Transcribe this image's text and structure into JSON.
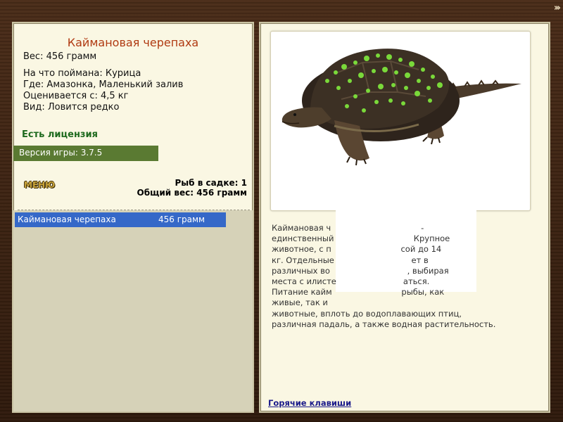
{
  "window": {
    "nav_arrows": "›››"
  },
  "fish": {
    "name": "Каймановая черепаха",
    "weight_label": "Вес: 456 грамм",
    "caught_on": "На что поймана: Курица",
    "location": "Где: Амазонка, Маленький залив",
    "valued_from": "Оценивается с: 4,5 кг",
    "rarity": "Вид: Ловится редко"
  },
  "license": {
    "label": "Есть лицензия",
    "color": "#1e6a1e"
  },
  "version": {
    "label": "Версия игры: 3.7.5",
    "bar_color": "#5a7a32"
  },
  "menu": {
    "label": "МЕНЮ"
  },
  "keepnet": {
    "count_label": "Рыб в садке: 1",
    "total_label": "Общий вес: 456 грамм"
  },
  "catch_list": [
    {
      "name": "Каймановая черепаха",
      "weight": "456 грамм",
      "selected": true
    }
  ],
  "description": "Каймановая черепаха - единственный крупное животное, с п сой до 14 кг. Отдельные ет в различных во , выбирая места с илисте аться. Питание кайм рыбы, как живые, так и животные, вплоть до водоплавающих птиц, различная падаль, а также водная растительность.",
  "description_lines": [
    "Каймановая ч                                   -",
    "единственный                               Крупное",
    "животное, с п                           сой до 14",
    "кг. Отдельные                              ет в",
    "различных во                              , выбирая",
    "места с илисте                          аться.",
    "Питание кайм                           рыбы, как",
    "живые, так и",
    "животные, вплоть до водоплавающих птиц,",
    "различная падаль, а также водная растительность."
  ],
  "hotkeys": {
    "label": "Горячие клавиши"
  },
  "colors": {
    "title": "#b03a12",
    "panel": "#faf7e3",
    "list_bg": "#d6d2b8",
    "selection": "#3568c8"
  }
}
